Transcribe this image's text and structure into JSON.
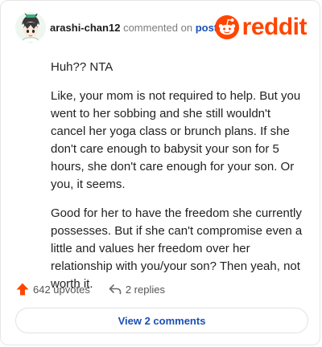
{
  "header": {
    "username": "arashi-chan12",
    "action_text": "commented on",
    "post_link": "post",
    "logo_text": "reddit",
    "avatar_icon": "anime-avatar-icon",
    "logo_icon": "reddit-alien-icon"
  },
  "comment": {
    "paragraphs": [
      "Huh?? NTA",
      "Like, your mom is not required to help. But you went to her sobbing and she still wouldn't cancel her yoga class or brunch plans. If she don't care enough to babysit your son for 5 hours, she don't care enough for your son. Or you, it seems.",
      "Good for her to have the freedom she currently possesses. But if she can't compromise even a little and values her freedom over her relationship with you/your son? Then yeah, not worth it."
    ]
  },
  "actions": {
    "upvotes": "642 upvotes",
    "replies": "2 replies",
    "upvote_icon": "upvote-arrow-icon",
    "reply_icon": "reply-arrow-icon"
  },
  "footer": {
    "view_comments": "View 2 comments"
  },
  "colors": {
    "brand": "#ff4500",
    "link": "#1a4fb5",
    "muted": "#7c7c7c"
  }
}
